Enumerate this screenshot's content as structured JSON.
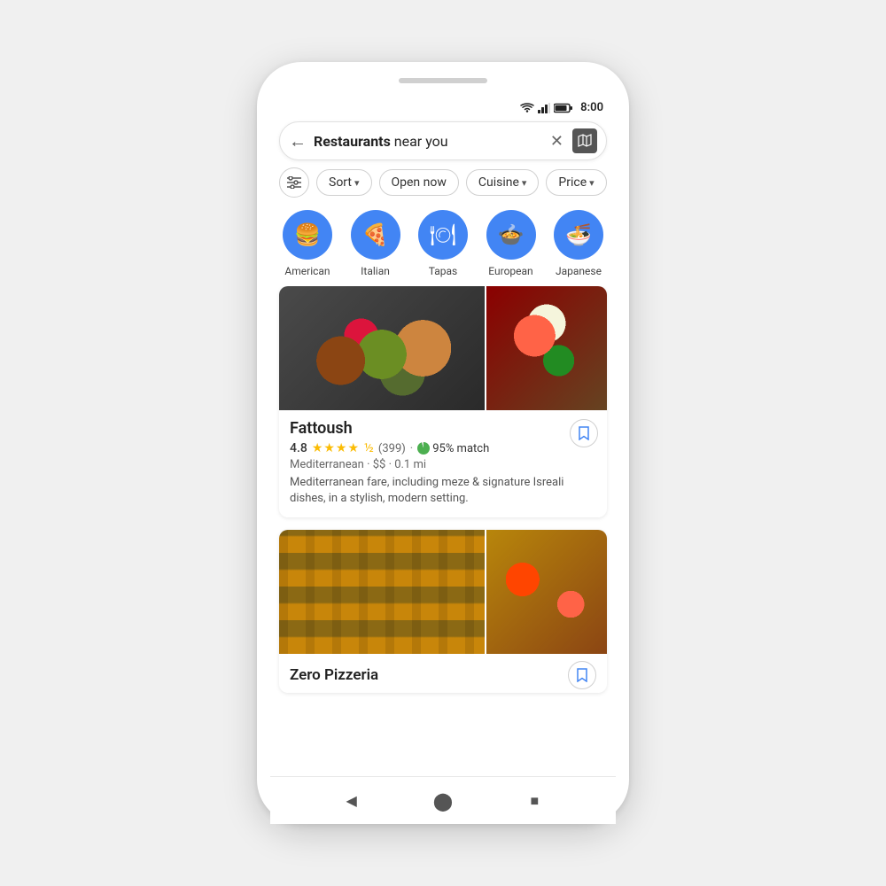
{
  "phone": {
    "status": {
      "time": "8:00"
    },
    "search": {
      "query_bold": "Restaurants",
      "query_rest": " near you",
      "back_label": "←",
      "clear_label": "✕"
    },
    "filters": {
      "tune_icon": "⊞",
      "chips": [
        {
          "label": "Sort",
          "has_arrow": true
        },
        {
          "label": "Open now",
          "has_arrow": false
        },
        {
          "label": "Cuisine",
          "has_arrow": true
        },
        {
          "label": "Price",
          "has_arrow": true
        }
      ]
    },
    "categories": [
      {
        "label": "American",
        "icon": "🍔"
      },
      {
        "label": "Italian",
        "icon": "🍕"
      },
      {
        "label": "Tapas",
        "icon": "🍽"
      },
      {
        "label": "European",
        "icon": "🍲"
      },
      {
        "label": "Japanese",
        "icon": "🍜"
      }
    ],
    "restaurants": [
      {
        "name": "Fattoush",
        "rating": "4.8",
        "reviews": "(399)",
        "match": "95% match",
        "cuisine": "Mediterranean",
        "price": "$$",
        "distance": "0.1 mi",
        "description": "Mediterranean fare, including meze & signature Isreali dishes, in a stylish, modern setting."
      },
      {
        "name": "Zero Pizzeria",
        "rating": "",
        "reviews": "",
        "match": "",
        "cuisine": "",
        "price": "",
        "distance": "",
        "description": ""
      }
    ],
    "nav": {
      "back_label": "◀",
      "home_label": "⬤",
      "square_label": "■"
    }
  }
}
